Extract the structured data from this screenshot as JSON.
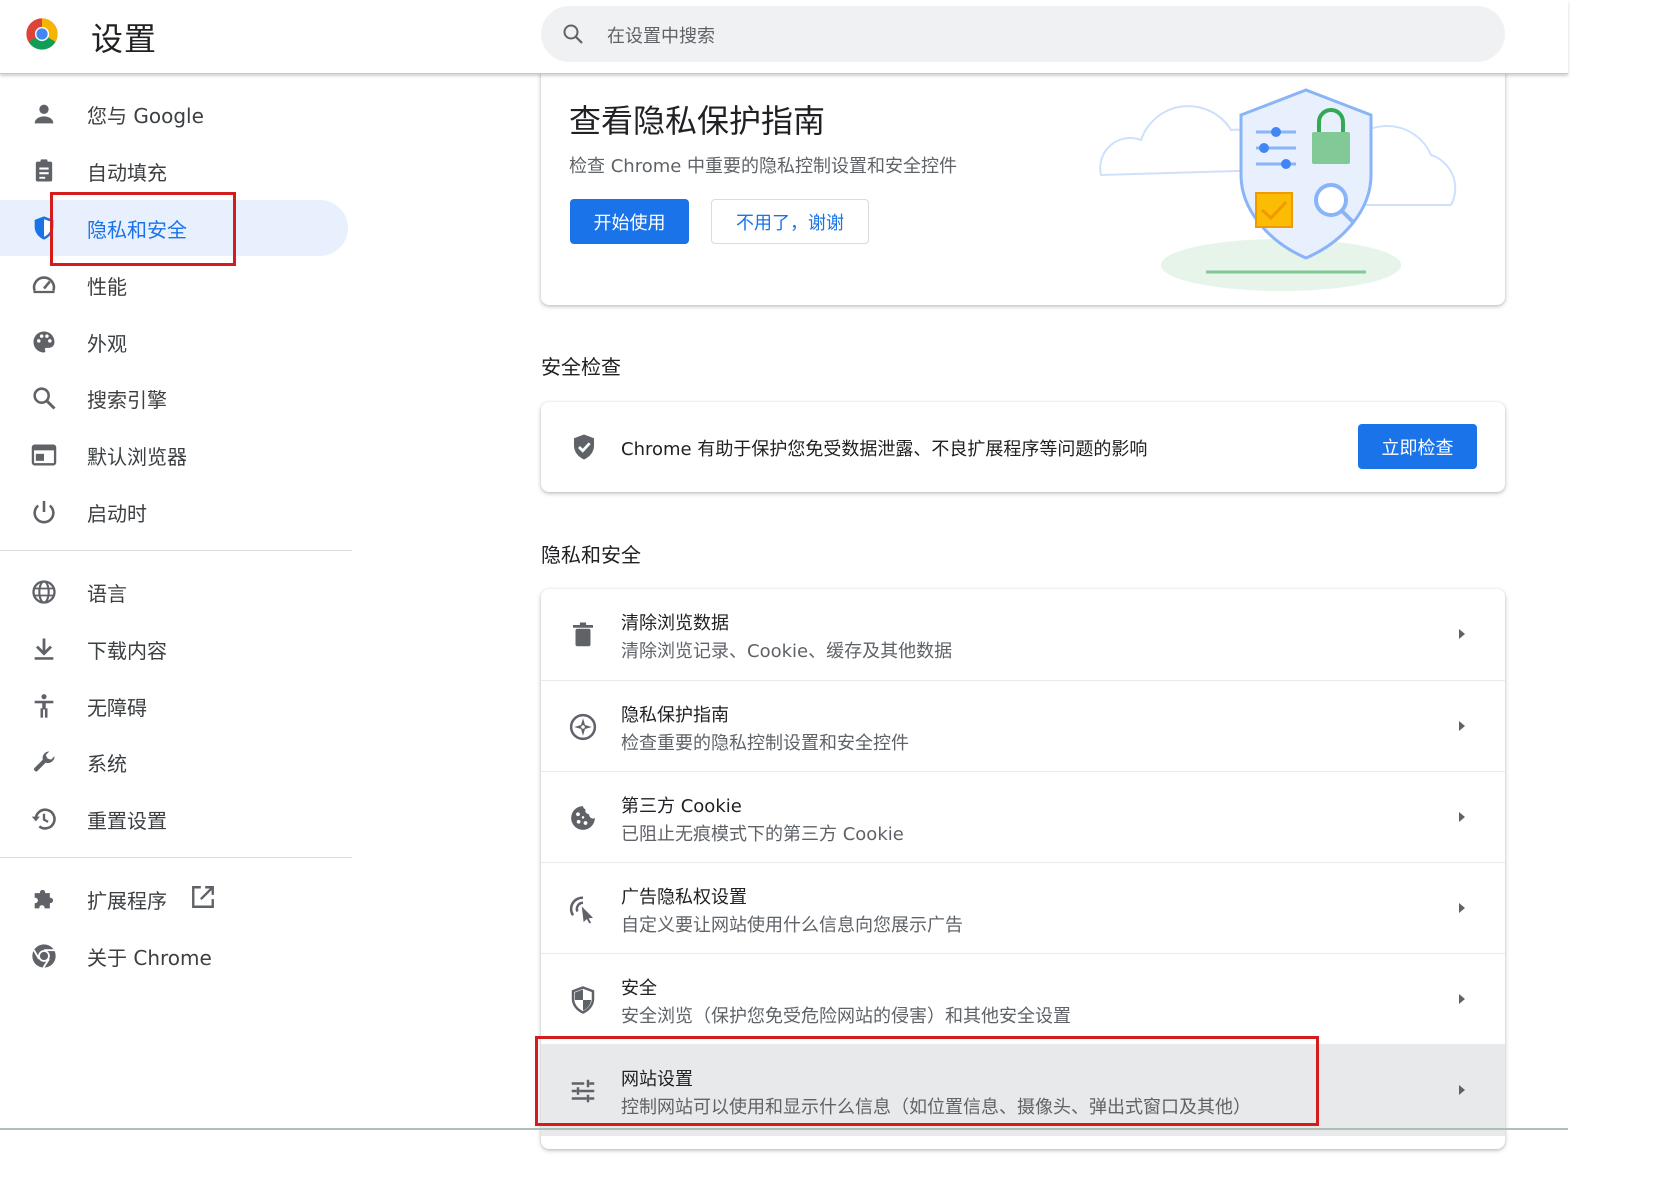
{
  "header": {
    "title": "设置",
    "search_placeholder": "在设置中搜索"
  },
  "sidebar": {
    "items": [
      {
        "label": "您与 Google",
        "icon": "person-icon"
      },
      {
        "label": "自动填充",
        "icon": "clipboard-icon"
      },
      {
        "label": "隐私和安全",
        "icon": "shield-icon",
        "active": true
      },
      {
        "label": "性能",
        "icon": "speedometer-icon"
      },
      {
        "label": "外观",
        "icon": "palette-icon"
      },
      {
        "label": "搜索引擎",
        "icon": "search-icon"
      },
      {
        "label": "默认浏览器",
        "icon": "browser-window-icon"
      },
      {
        "label": "启动时",
        "icon": "power-icon"
      },
      {
        "label": "语言",
        "icon": "globe-icon"
      },
      {
        "label": "下载内容",
        "icon": "download-icon"
      },
      {
        "label": "无障碍",
        "icon": "accessibility-icon"
      },
      {
        "label": "系统",
        "icon": "wrench-icon"
      },
      {
        "label": "重置设置",
        "icon": "history-icon"
      },
      {
        "label": "扩展程序",
        "icon": "puzzle-icon"
      },
      {
        "label": "关于 Chrome",
        "icon": "chrome-icon"
      }
    ]
  },
  "promo": {
    "title": "查看隐私保护指南",
    "description": "检查 Chrome 中重要的隐私控制设置和安全控件",
    "start_button": "开始使用",
    "dismiss_button": "不用了，谢谢"
  },
  "safety_check": {
    "section_title": "安全检查",
    "text": "Chrome 有助于保护您免受数据泄露、不良扩展程序等问题的影响",
    "button": "立即检查"
  },
  "privacy": {
    "section_title": "隐私和安全",
    "rows": [
      {
        "title": "清除浏览数据",
        "subtitle": "清除浏览记录、Cookie、缓存及其他数据",
        "icon": "trash-icon"
      },
      {
        "title": "隐私保护指南",
        "subtitle": "检查重要的隐私控制设置和安全控件",
        "icon": "compass-icon"
      },
      {
        "title": "第三方 Cookie",
        "subtitle": "已阻止无痕模式下的第三方 Cookie",
        "icon": "cookie-icon"
      },
      {
        "title": "广告隐私权设置",
        "subtitle": "自定义要让网站使用什么信息向您展示广告",
        "icon": "ad-privacy-icon"
      },
      {
        "title": "安全",
        "subtitle": "安全浏览（保护您免受危险网站的侵害）和其他安全设置",
        "icon": "security-shield-icon"
      },
      {
        "title": "网站设置",
        "subtitle": "控制网站可以使用和显示什么信息（如位置信息、摄像头、弹出式窗口及其他）",
        "icon": "tune-icon"
      }
    ]
  },
  "colors": {
    "accent": "#1a73e8",
    "active_bg": "#e8f0fe",
    "highlight": "#d41c1c"
  }
}
